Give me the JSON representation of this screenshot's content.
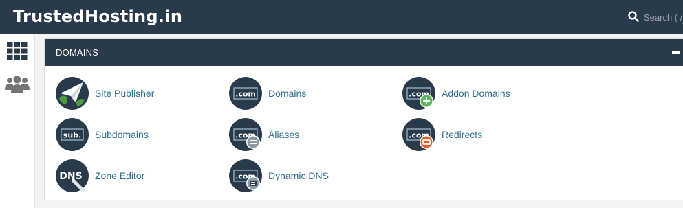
{
  "header": {
    "brand": "TrustedHosting.in",
    "search_placeholder": "Search ( /",
    "search_icon": "search-icon"
  },
  "sidebar": {
    "items": [
      {
        "icon": "grid-icon"
      },
      {
        "icon": "users-icon"
      }
    ]
  },
  "panel": {
    "title": "DOMAINS",
    "collapse_icon": "minus-icon",
    "items": [
      {
        "label": "Site Publisher",
        "icon": "site-publisher-icon"
      },
      {
        "label": "Domains",
        "icon": "domains-icon"
      },
      {
        "label": "Addon Domains",
        "icon": "addon-domains-icon"
      },
      {
        "label": "Subdomains",
        "icon": "subdomains-icon"
      },
      {
        "label": "Aliases",
        "icon": "aliases-icon"
      },
      {
        "label": "Redirects",
        "icon": "redirects-icon"
      },
      {
        "label": "Zone Editor",
        "icon": "zone-editor-icon"
      },
      {
        "label": "Dynamic DNS",
        "icon": "dynamic-dns-icon"
      }
    ],
    "icon_text": {
      "com": ".com",
      "sub": "sub.",
      "dns": "DNS"
    }
  },
  "colors": {
    "header_bg": "#293a4a",
    "link": "#31708f",
    "icon_bg": "#293a4a",
    "add_green": "#5cb85c",
    "redirect_orange": "#e8602c",
    "alias_gray": "#8e9aa6"
  }
}
